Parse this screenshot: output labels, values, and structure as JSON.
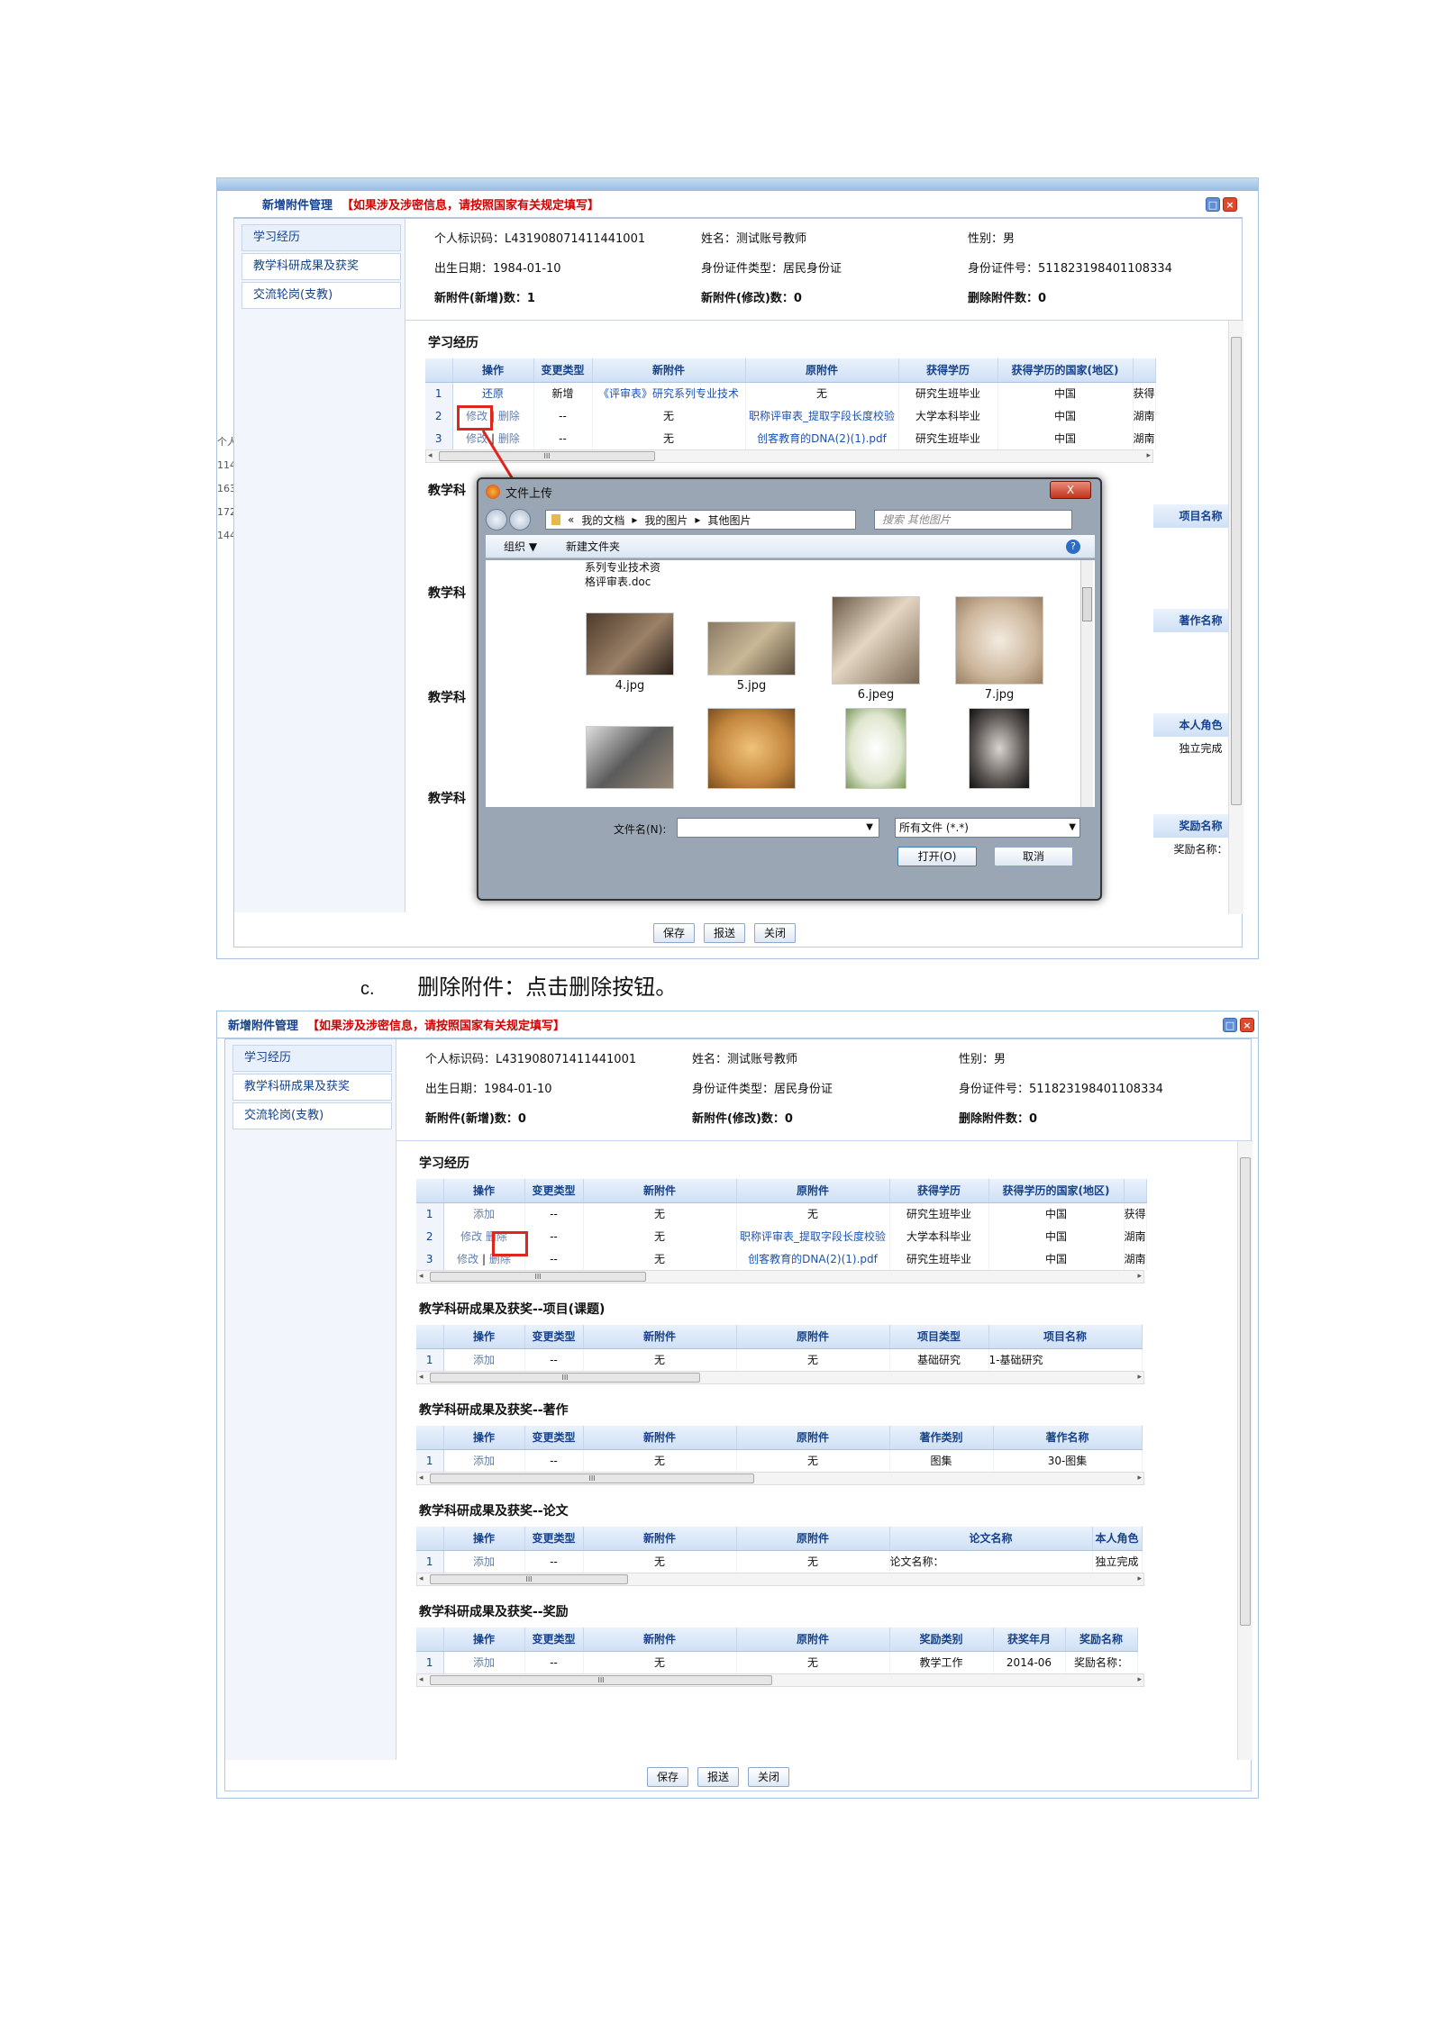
{
  "caption": {
    "letter": "c.",
    "text": "删除附件：点击删除按钮。"
  },
  "window": {
    "title": "新增附件管理",
    "warning": "【如果涉及涉密信息，请按照国家有关规定填写】",
    "sidebar": [
      "学习经历",
      "教学科研成果及获奖",
      "交流轮岗(支教)"
    ],
    "buttons": {
      "save": "保存",
      "submit": "报送",
      "close": "关闭"
    }
  },
  "info1": {
    "id": "个人标识码：L431908071411441001",
    "name": "姓名：测试账号教师",
    "sex": "性别：男",
    "birth": "出生日期：1984-01-10",
    "idtype": "身份证件类型：居民身份证",
    "idno": "身份证件号：511823198401108334",
    "added": "新附件(新增)数：1",
    "modified": "新附件(修改)数：0",
    "deleted": "删除附件数：0"
  },
  "info2": {
    "id": "个人标识码：L431908071411441001",
    "name": "姓名：测试账号教师",
    "sex": "性别：男",
    "birth": "出生日期：1984-01-10",
    "idtype": "身份证件类型：居民身份证",
    "idno": "身份证件号：511823198401108334",
    "added": "新附件(新增)数：0",
    "modified": "新附件(修改)数：0",
    "deleted": "删除附件数：0"
  },
  "sections1": {
    "study": "学习经历",
    "s2": "教学科",
    "s3": "教学科",
    "s4": "教学科",
    "s5": "教学科"
  },
  "table_headers": {
    "op": "操作",
    "chg": "变更类型",
    "newatt": "新附件",
    "origatt": "原附件",
    "degree": "获得学历",
    "country": "获得学历的国家(地区)",
    "ptype": "项目类型",
    "pname": "项目名称",
    "wtype": "著作类别",
    "wname": "著作名称",
    "tname": "论文名称",
    "role": "本人角色",
    "atype": "奖励类别",
    "ayear": "获奖年月",
    "aname": "奖励名称"
  },
  "study_rows1": [
    {
      "n": "1",
      "op1": "还原",
      "op2": "",
      "chg": "新增",
      "new": "《评审表》研究系列专业技术",
      "orig": "无",
      "deg": "研究生班毕业",
      "cty": "中国",
      "extra": "获得"
    },
    {
      "n": "2",
      "op1": "修改",
      "op2": "删除",
      "chg": "--",
      "new": "无",
      "orig": "职称评审表_提取字段长度校验",
      "deg": "大学本科毕业",
      "cty": "中国",
      "extra": "湖南"
    },
    {
      "n": "3",
      "op1": "修改",
      "op2": "删除",
      "chg": "--",
      "new": "无",
      "orig": "创客教育的DNA(2)(1).pdf",
      "deg": "研究生班毕业",
      "cty": "中国",
      "extra": "湖南"
    }
  ],
  "study_rows2": [
    {
      "n": "1",
      "op1": "添加",
      "op2": "",
      "chg": "--",
      "new": "无",
      "orig": "无",
      "deg": "研究生班毕业",
      "cty": "中国",
      "extra": "获得"
    },
    {
      "n": "2",
      "op1": "修改",
      "op2": "删除",
      "chg": "--",
      "new": "无",
      "orig": "职称评审表_提取字段长度校验",
      "deg": "大学本科毕业",
      "cty": "中国",
      "extra": "湖南"
    },
    {
      "n": "3",
      "op1": "修改",
      "op2": "删除",
      "chg": "--",
      "new": "无",
      "orig": "创客教育的DNA(2)(1).pdf",
      "deg": "研究生班毕业",
      "cty": "中国",
      "extra": "湖南"
    }
  ],
  "partial1": {
    "s2_head": "项目名称",
    "s3_head": "著作名称",
    "s4_head": "本人角色",
    "s4_val": "独立完成",
    "s5_head": "奖励名称",
    "s5_val": "奖励名称："
  },
  "sections2": {
    "proj": "教学科研成果及获奖--项目(课题)",
    "work": "教学科研成果及获奖--著作",
    "thesis": "教学科研成果及获奖--论文",
    "award": "教学科研成果及获奖--奖励"
  },
  "proj_row": {
    "n": "1",
    "op": "添加",
    "chg": "--",
    "new": "无",
    "orig": "无",
    "type": "基础研究",
    "name": "1-基础研究"
  },
  "work_row": {
    "n": "1",
    "op": "添加",
    "chg": "--",
    "new": "无",
    "orig": "无",
    "type": "图集",
    "name": "30-图集"
  },
  "thesis_row": {
    "n": "1",
    "op": "添加",
    "chg": "--",
    "new": "无",
    "orig": "无",
    "name": "论文名称：",
    "role": "独立完成"
  },
  "award_row": {
    "n": "1",
    "op": "添加",
    "chg": "--",
    "new": "无",
    "orig": "无",
    "type": "教学工作",
    "year": "2014-06",
    "name": "奖励名称："
  },
  "scroll_mark": "III",
  "left_clip": [
    "个人",
    "114",
    "163",
    "172",
    "144"
  ],
  "dialog": {
    "title": "文件上传",
    "close": "X",
    "path": [
      "«",
      "我的文档",
      "我的图片",
      "其他图片"
    ],
    "search": "搜索 其他图片",
    "organize": "组织 ▼",
    "newfolder": "新建文件夹",
    "partial_file": [
      "系列专业技术资",
      "格评审表.doc"
    ],
    "files": [
      "4.jpg",
      "5.jpg",
      "6.jpeg",
      "7.jpg"
    ],
    "filename_label": "文件名(N):",
    "filetype": "所有文件 (*.*)",
    "open": "打开(O)",
    "cancel": "取消"
  }
}
